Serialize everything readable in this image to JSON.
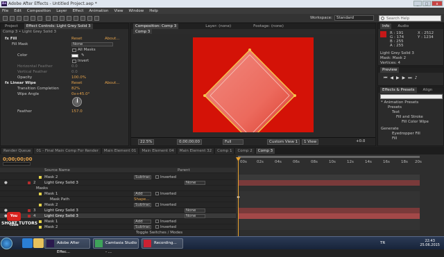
{
  "window": {
    "title": "Adobe After Effects - Untitled Project.aep *",
    "minimize": "_",
    "maximize": "□",
    "close": "x"
  },
  "menu": [
    "File",
    "Edit",
    "Composition",
    "Layer",
    "Effect",
    "Animation",
    "View",
    "Window",
    "Help"
  ],
  "toolbar": {
    "workspace_label": "Workspace:",
    "workspace_value": "Standard",
    "search_placeholder": "Search Help"
  },
  "effect_controls": {
    "tabs": [
      "Project",
      "Effect Controls: Light Grey Solid 3"
    ],
    "header": "Comp 3 • Light Grey Solid 3",
    "rows": [
      {
        "label": "fx  Fill",
        "reset": "Reset",
        "about": "About..."
      },
      {
        "label": "Fill Mask",
        "value": "None"
      },
      {
        "label": "",
        "value": "All Masks"
      },
      {
        "label": "Color",
        "value": ""
      },
      {
        "label": "",
        "value": "Invert"
      },
      {
        "label": "Horizontal Feather",
        "value": "0.0"
      },
      {
        "label": "Vertical Feather",
        "value": "0.0"
      },
      {
        "label": "Opacity",
        "value": "100.0%"
      },
      {
        "label": "fx  Linear Wipe",
        "reset": "Reset",
        "about": "About..."
      },
      {
        "label": "Transition Completion",
        "value": "82%"
      },
      {
        "label": "Wipe Angle",
        "value": "0x+45.0°"
      },
      {
        "label": "Feather",
        "value": "157.0"
      }
    ]
  },
  "composition": {
    "tabs": [
      "Composition: Comp 3",
      "Layer: (none)",
      "Footage: (none)"
    ],
    "subtab": "Comp 3",
    "canvas_color": "#d41207",
    "controls": {
      "zoom": "22.5%",
      "timecode": "0;00;00;00",
      "quality": "Full",
      "view": "Custom View 1",
      "views": "1 View",
      "exposure": "+0.0"
    }
  },
  "info": {
    "tabs": [
      "Info",
      "Audio"
    ],
    "r": "R : 191",
    "g": "G : 174",
    "b": "B : 255",
    "a": "A : 255",
    "x": "X : 2512",
    "y": "Y : 1234",
    "layer": "Light Grey Solid 3",
    "mask": "Mask: Mask 2",
    "vertices": "Vertices: 4"
  },
  "preview": {
    "title": "Preview"
  },
  "effects_presets": {
    "tabs": [
      "Effects & Presets",
      "Align"
    ],
    "items": [
      "* Animation Presets",
      "Presets",
      "Text",
      "Fill and Stroke",
      "Fill Color Wipe",
      "Generate",
      "Eyedropper Fill",
      "Fill"
    ]
  },
  "timeline_tabs": [
    "Render Queue",
    "01 - Final Main Comp For Render",
    "Main Element 01",
    "Main Element 04",
    "Main Element 32",
    "Comp 1",
    "Comp 2",
    "Comp 3"
  ],
  "timeline": {
    "timecode": "0;00;00;00",
    "col_source": "Source Name",
    "col_parent": "Parent",
    "rows": [
      {
        "name": "Mask 2",
        "mode": "Subtrac",
        "inverted": "Inverted",
        "parent": ""
      },
      {
        "name": "Light Grey Solid 3",
        "mode": "Normal",
        "inverted": "",
        "parent": "None"
      },
      {
        "name": "Masks",
        "mode": "",
        "inverted": "",
        "parent": ""
      },
      {
        "name": "Mask 1",
        "mode": "Add",
        "inverted": "Inverted",
        "parent": ""
      },
      {
        "name": "Mask Path",
        "mode": "Shape...",
        "inverted": "",
        "parent": ""
      },
      {
        "name": "Mask 2",
        "mode": "Subtrac",
        "inverted": "Inverted",
        "parent": ""
      },
      {
        "name": "Light Grey Solid 3",
        "mode": "Normal",
        "inverted": "",
        "parent": "None"
      },
      {
        "name": "Light Grey Solid 3",
        "mode": "Normal",
        "inverted": "",
        "parent": "None"
      },
      {
        "name": "Mask 1",
        "mode": "Add",
        "inverted": "Inverted",
        "parent": ""
      },
      {
        "name": "Mask 2",
        "mode": "Subtrac",
        "inverted": "Inverted",
        "parent": ""
      }
    ],
    "toggle": "Toggle Switches / Modes",
    "ruler": [
      "00s",
      "02s",
      "04s",
      "06s",
      "08s",
      "10s",
      "12s",
      "14s",
      "16s",
      "18s",
      "20s"
    ]
  },
  "watermark": {
    "yt": "You Tube",
    "text": "SHORT TUTORS"
  },
  "taskbar": {
    "apps": [
      "Adobe After Effec...",
      "Camtasia Studio - ...",
      "Recording..."
    ],
    "lang": "TR",
    "time": "22:43",
    "date": "25.06.2015"
  }
}
